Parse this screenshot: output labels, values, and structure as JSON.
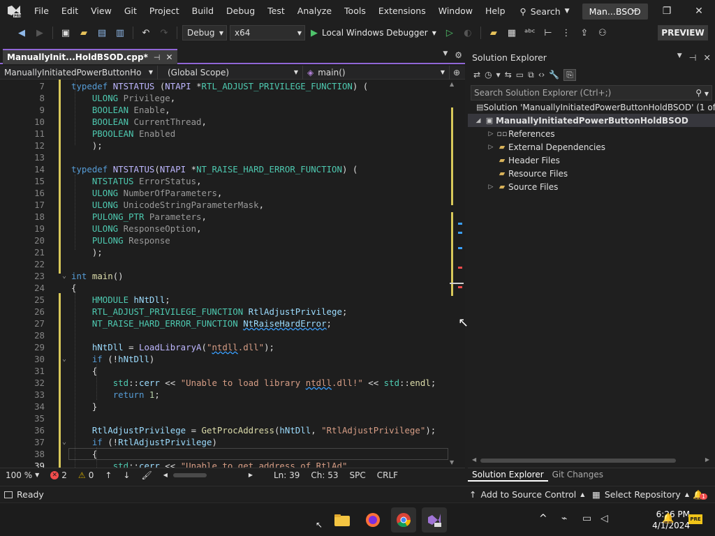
{
  "menu": {
    "items": [
      "File",
      "Edit",
      "View",
      "Git",
      "Project",
      "Build",
      "Debug",
      "Test",
      "Analyze",
      "Tools",
      "Extensions",
      "Window",
      "Help"
    ],
    "search_label": "Search",
    "solution_badge": "Man...BSOD"
  },
  "toolbar": {
    "config": "Debug",
    "platform": "x64",
    "run_label": "Local Windows Debugger",
    "preview_label": "PREVIEW"
  },
  "editor": {
    "tab_label": "ManuallyInit...HoldBSOD.cpp*",
    "nav_project": "ManuallyInitiatedPowerButtonHo",
    "nav_scope": "(Global Scope)",
    "nav_member": "main()",
    "current_line": "39",
    "line_numbers": [
      "7",
      "8",
      "9",
      "10",
      "11",
      "12",
      "13",
      "14",
      "15",
      "16",
      "17",
      "18",
      "19",
      "20",
      "21",
      "22",
      "23",
      "24",
      "25",
      "26",
      "27",
      "28",
      "29",
      "30",
      "31",
      "32",
      "33",
      "34",
      "35",
      "36",
      "37",
      "38",
      "39"
    ]
  },
  "editor_status": {
    "zoom": "100 %",
    "errors": "2",
    "warnings": "0",
    "ln": "Ln: 39",
    "ch": "Ch: 53",
    "spc": "SPC",
    "eol": "CRLF"
  },
  "solution_explorer": {
    "title": "Solution Explorer",
    "search_placeholder": "Search Solution Explorer (Ctrl+;)",
    "solution_label": "Solution 'ManuallyInitiatedPowerButtonHoldBSOD' (1 of 1",
    "project_label": "ManuallyInitiatedPowerButtonHoldBSOD",
    "nodes": [
      "References",
      "External Dependencies",
      "Header Files",
      "Resource Files",
      "Source Files"
    ],
    "tabs": [
      "Solution Explorer",
      "Git Changes"
    ]
  },
  "statusbar": {
    "ready": "Ready",
    "add_source_control": "Add to Source Control",
    "select_repository": "Select Repository",
    "notifications": "1"
  },
  "taskbar": {
    "time": "6:26 PM",
    "date": "4/1/2024"
  },
  "colors": {
    "accent": "#9066d6",
    "error": "#f14c4c",
    "warning": "#cca700"
  }
}
